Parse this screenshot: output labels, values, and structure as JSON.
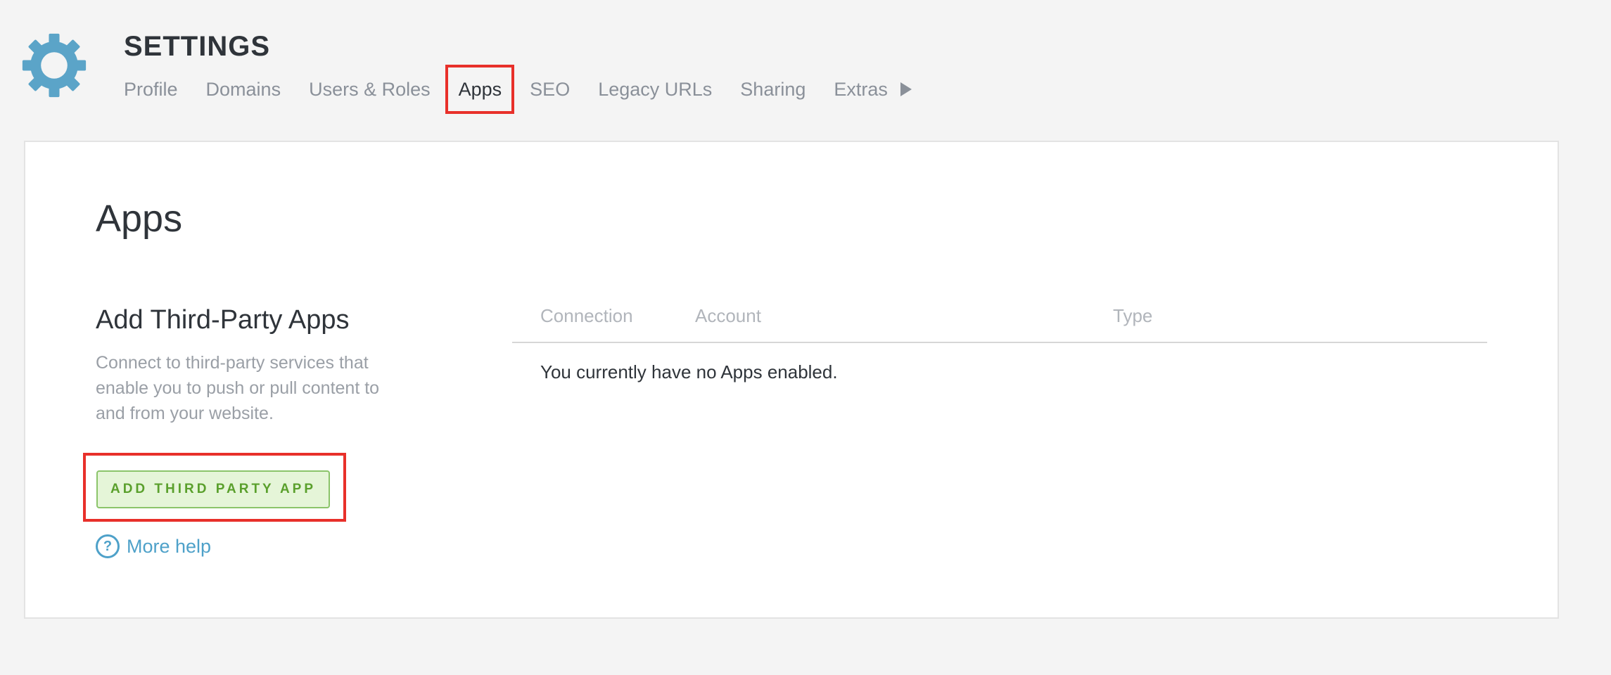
{
  "header": {
    "title": "SETTINGS",
    "icon": "gear-icon",
    "icon_color": "#5ba4c8"
  },
  "nav": {
    "items": [
      {
        "label": "Profile"
      },
      {
        "label": "Domains"
      },
      {
        "label": "Users & Roles"
      },
      {
        "label": "Apps",
        "active": true
      },
      {
        "label": "SEO"
      },
      {
        "label": "Legacy URLs"
      },
      {
        "label": "Sharing"
      },
      {
        "label": "Extras"
      }
    ],
    "more_icon": "triangle-right-icon"
  },
  "main": {
    "page_title": "Apps",
    "section": {
      "title": "Add Third-Party Apps",
      "description": "Connect to third-party services that enable you to push or pull content to and from your website.",
      "button_label": "ADD THIRD PARTY APP",
      "help_icon": "?",
      "help_label": "More help"
    },
    "table": {
      "columns": [
        "Connection",
        "Account",
        "Type"
      ],
      "empty_message": "You currently have no Apps enabled."
    }
  },
  "colors": {
    "highlight": "#e8302a",
    "button_text": "#5aa02c",
    "button_bg": "#e5f5d8",
    "link": "#4ea1c9"
  }
}
